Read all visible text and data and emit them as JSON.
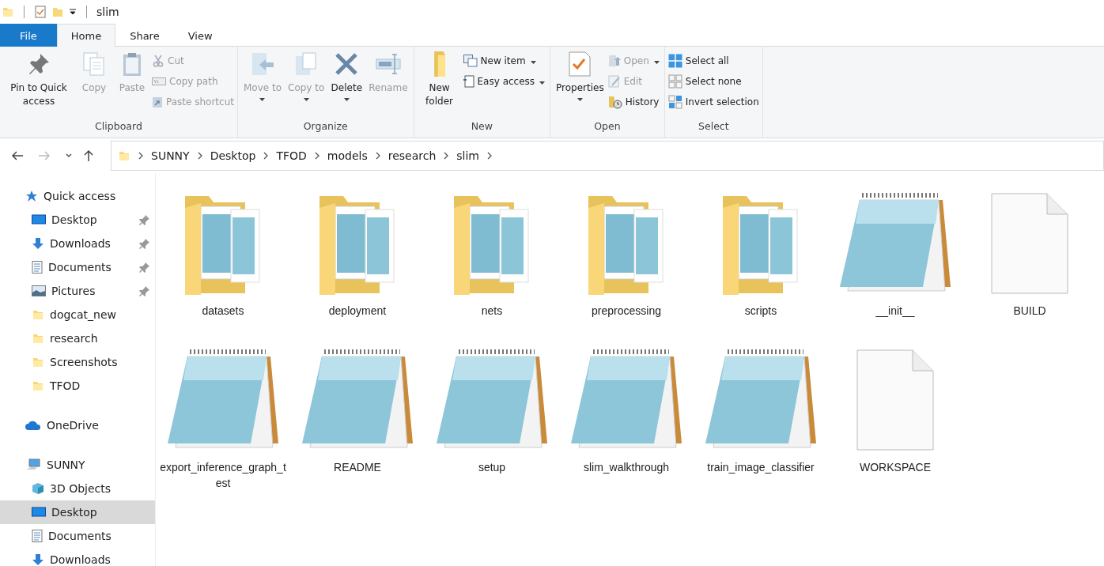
{
  "window": {
    "title": "slim"
  },
  "tabs": [
    {
      "label": "File",
      "kind": "file",
      "selected": false
    },
    {
      "label": "Home",
      "kind": "tab",
      "selected": true
    },
    {
      "label": "Share",
      "kind": "tab",
      "selected": false
    },
    {
      "label": "View",
      "kind": "tab",
      "selected": false
    }
  ],
  "ribbon": [
    {
      "label": "Clipboard",
      "items": [
        {
          "label": "Pin to Quick access",
          "kind": "large",
          "disabled": false
        },
        {
          "label": "Copy",
          "kind": "large",
          "disabled": true
        },
        {
          "label": "Paste",
          "kind": "large",
          "disabled": true
        },
        {
          "label": "Cut",
          "kind": "small",
          "disabled": true
        },
        {
          "label": "Copy path",
          "kind": "small",
          "disabled": true
        },
        {
          "label": "Paste shortcut",
          "kind": "small",
          "disabled": true
        }
      ]
    },
    {
      "label": "Organize",
      "items": [
        {
          "label": "Move to",
          "kind": "large",
          "disabled": true,
          "dropdown": true
        },
        {
          "label": "Copy to",
          "kind": "large",
          "disabled": true,
          "dropdown": true
        },
        {
          "label": "Delete",
          "kind": "large",
          "disabled": false,
          "dropdown": true
        },
        {
          "label": "Rename",
          "kind": "large",
          "disabled": true
        }
      ]
    },
    {
      "label": "New",
      "items": [
        {
          "label": "New folder",
          "kind": "large",
          "disabled": false
        },
        {
          "label": "New item",
          "kind": "small",
          "disabled": false,
          "dropdown": true
        },
        {
          "label": "Easy access",
          "kind": "small",
          "disabled": false,
          "dropdown": true
        }
      ]
    },
    {
      "label": "Open",
      "items": [
        {
          "label": "Properties",
          "kind": "large",
          "disabled": false,
          "dropdown": true
        },
        {
          "label": "Open",
          "kind": "small",
          "disabled": true,
          "dropdown": true
        },
        {
          "label": "Edit",
          "kind": "small",
          "disabled": true
        },
        {
          "label": "History",
          "kind": "small",
          "disabled": false
        }
      ]
    },
    {
      "label": "Select",
      "items": [
        {
          "label": "Select all",
          "kind": "small",
          "disabled": false
        },
        {
          "label": "Select none",
          "kind": "small",
          "disabled": false
        },
        {
          "label": "Invert selection",
          "kind": "small",
          "disabled": false
        }
      ]
    }
  ],
  "breadcrumb": [
    "SUNNY",
    "Desktop",
    "TFOD",
    "models",
    "research",
    "slim"
  ],
  "sidebar": [
    {
      "label": "Quick access",
      "kind": "star",
      "children": [
        {
          "label": "Desktop",
          "kind": "desktop",
          "pinned": true,
          "selected": false
        },
        {
          "label": "Downloads",
          "kind": "downloads",
          "pinned": true,
          "selected": false
        },
        {
          "label": "Documents",
          "kind": "documents",
          "pinned": true,
          "selected": false
        },
        {
          "label": "Pictures",
          "kind": "pictures",
          "pinned": true,
          "selected": false
        },
        {
          "label": "dogcat_new",
          "kind": "folder",
          "pinned": false,
          "selected": false
        },
        {
          "label": "research",
          "kind": "folder",
          "pinned": false,
          "selected": false
        },
        {
          "label": "Screenshots",
          "kind": "folder",
          "pinned": false,
          "selected": false
        },
        {
          "label": "TFOD",
          "kind": "folder",
          "pinned": false,
          "selected": false
        }
      ]
    },
    {
      "label": "OneDrive",
      "kind": "cloud"
    },
    {
      "label": "SUNNY",
      "kind": "computer",
      "children": [
        {
          "label": "3D Objects",
          "kind": "cube",
          "pinned": false,
          "selected": false
        },
        {
          "label": "Desktop",
          "kind": "desktop",
          "pinned": false,
          "selected": true
        },
        {
          "label": "Documents",
          "kind": "documents",
          "pinned": false,
          "selected": false
        },
        {
          "label": "Downloads",
          "kind": "downloads",
          "pinned": false,
          "selected": false
        }
      ]
    }
  ],
  "files": [
    {
      "name": "datasets",
      "kind": "folder"
    },
    {
      "name": "deployment",
      "kind": "folder"
    },
    {
      "name": "nets",
      "kind": "folder"
    },
    {
      "name": "preprocessing",
      "kind": "folder"
    },
    {
      "name": "scripts",
      "kind": "folder"
    },
    {
      "name": "__init__",
      "kind": "notepad"
    },
    {
      "name": "BUILD",
      "kind": "blank"
    },
    {
      "name": "export_inference_graph_test",
      "kind": "notepad"
    },
    {
      "name": "README",
      "kind": "notepad"
    },
    {
      "name": "setup",
      "kind": "notepad"
    },
    {
      "name": "slim_walkthrough",
      "kind": "notepad"
    },
    {
      "name": "train_image_classifier",
      "kind": "notepad"
    },
    {
      "name": "WORKSPACE",
      "kind": "blank"
    }
  ]
}
